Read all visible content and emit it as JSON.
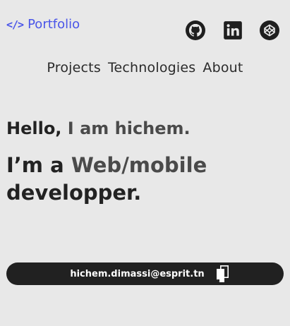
{
  "header": {
    "brand_icon": "</>",
    "brand_label": "Portfolio",
    "brand_color": "#4a55e8",
    "socials": [
      {
        "name": "github",
        "icon": "github-icon"
      },
      {
        "name": "linkedin",
        "icon": "linkedin-icon"
      },
      {
        "name": "codepen",
        "icon": "codepen-icon"
      }
    ]
  },
  "nav": {
    "items": [
      {
        "label": "Projects"
      },
      {
        "label": "Technologies"
      },
      {
        "label": "About"
      }
    ]
  },
  "hero": {
    "greeting_prefix": "Hello,",
    "greeting_name": "I am hichem.",
    "role_prefix": "I’m a",
    "role_highlight": "Web/mobile",
    "role_suffix": "developper."
  },
  "contact": {
    "email": "hichem.dimassi@esprit.tn",
    "copy_icon": "copy-icon",
    "bar_color": "#212121"
  }
}
